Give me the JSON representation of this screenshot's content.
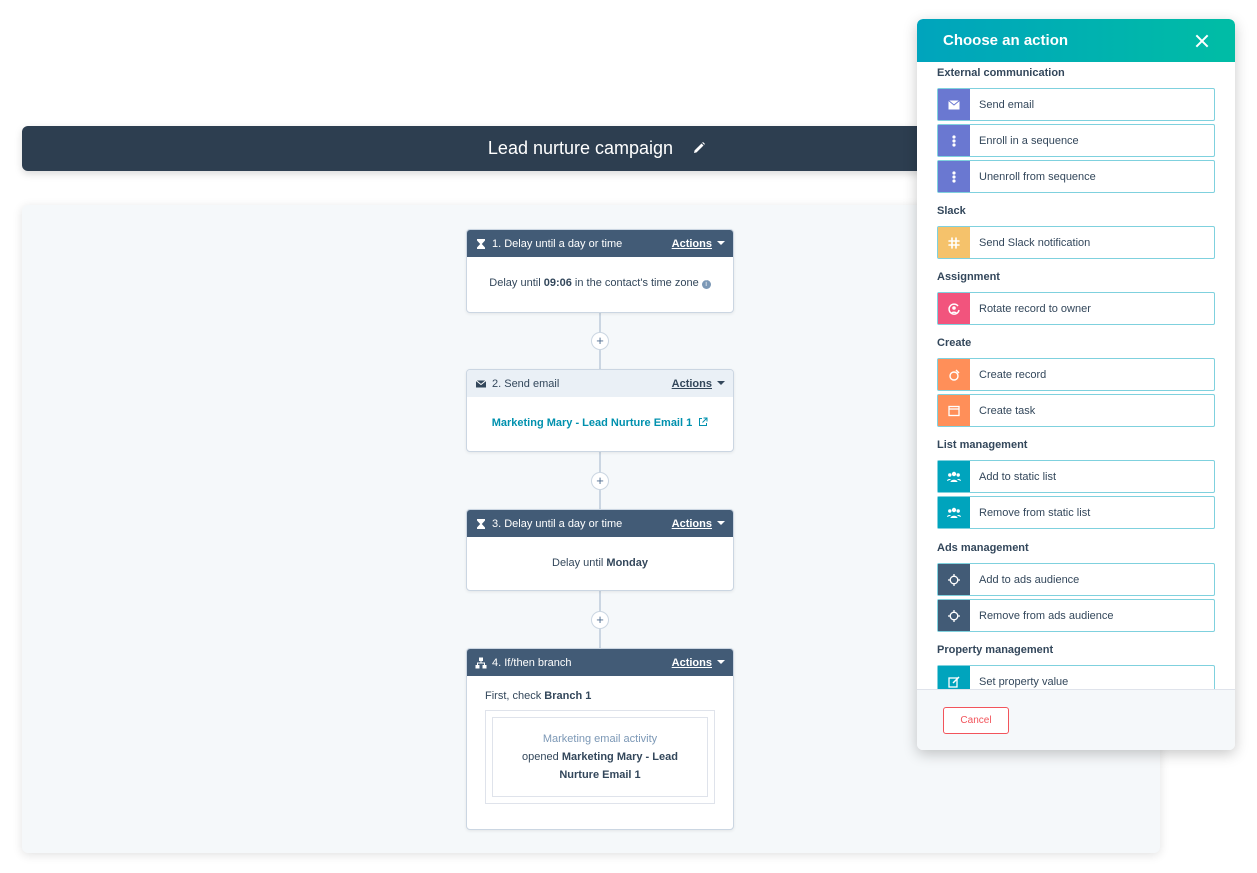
{
  "header": {
    "title": "Lead nurture campaign"
  },
  "workflow": {
    "actions_label": "Actions",
    "add_symbol": "+",
    "steps": [
      {
        "title": "1. Delay until a day or time",
        "body_prefix": "Delay until ",
        "body_strong": "09:06",
        "body_suffix": " in the contact's time zone"
      },
      {
        "title": "2. Send email",
        "link": "Marketing Mary - Lead Nurture Email 1"
      },
      {
        "title": "3. Delay until a day or time",
        "body_prefix": "Delay until ",
        "body_strong": "Monday"
      },
      {
        "title": "4. If/then branch",
        "check_prefix": "First, check ",
        "check_strong": "Branch 1",
        "criteria_title": "Marketing email activity",
        "criteria_prefix": "opened ",
        "criteria_strong": "Marketing Mary - Lead Nurture Email 1"
      }
    ]
  },
  "panel": {
    "title": "Choose an action",
    "cancel_label": "Cancel",
    "sections": [
      {
        "title": "External communication",
        "items": [
          {
            "label": "Send email",
            "icon": "envelope-icon",
            "color": "#6a78d1"
          },
          {
            "label": "Enroll in a sequence",
            "icon": "sequence-icon",
            "color": "#6a78d1"
          },
          {
            "label": "Unenroll from sequence",
            "icon": "sequence-icon",
            "color": "#6a78d1"
          }
        ]
      },
      {
        "title": "Slack",
        "items": [
          {
            "label": "Send Slack notification",
            "icon": "slack-icon",
            "color": "#f5c26b"
          }
        ]
      },
      {
        "title": "Assignment",
        "items": [
          {
            "label": "Rotate record to owner",
            "icon": "rotate-owner-icon",
            "color": "#f2547d"
          }
        ]
      },
      {
        "title": "Create",
        "items": [
          {
            "label": "Create record",
            "icon": "create-record-icon",
            "color": "#ff8f59"
          },
          {
            "label": "Create task",
            "icon": "task-icon",
            "color": "#ff8f59"
          }
        ]
      },
      {
        "title": "List management",
        "items": [
          {
            "label": "Add to static list",
            "icon": "people-icon",
            "color": "#00a4bd"
          },
          {
            "label": "Remove from static list",
            "icon": "people-icon",
            "color": "#00a4bd"
          }
        ]
      },
      {
        "title": "Ads management",
        "items": [
          {
            "label": "Add to ads audience",
            "icon": "target-icon",
            "color": "#425b76"
          },
          {
            "label": "Remove from ads audience",
            "icon": "target-icon",
            "color": "#425b76"
          }
        ]
      },
      {
        "title": "Property management",
        "items": [
          {
            "label": "Set property value",
            "icon": "edit-icon",
            "color": "#00a4bd"
          }
        ]
      }
    ]
  }
}
